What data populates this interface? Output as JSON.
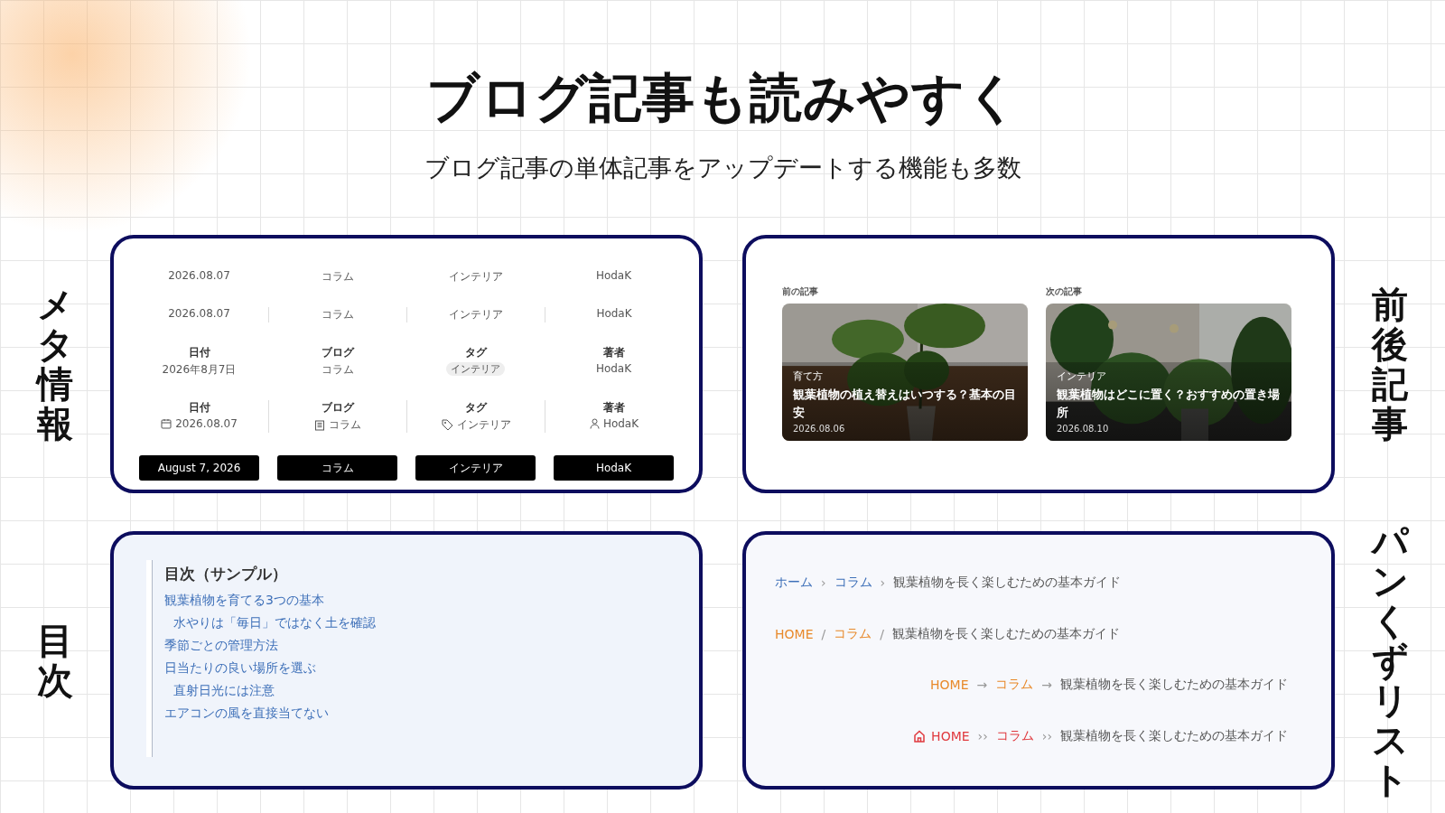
{
  "title": "ブログ記事も読みやすく",
  "subtitle": "ブログ記事の単体記事をアップデートする機能も多数",
  "meta": {
    "side_label": "メタ情報",
    "rows": [
      {
        "kind": "plain",
        "items": [
          {
            "value": "2026.08.07"
          },
          {
            "value": "コラム"
          },
          {
            "value": "インテリア"
          },
          {
            "value": "HodaK"
          }
        ]
      },
      {
        "kind": "divided",
        "items": [
          {
            "value": "2026.08.07"
          },
          {
            "value": "コラム"
          },
          {
            "value": "インテリア"
          },
          {
            "value": "HodaK"
          }
        ]
      },
      {
        "kind": "labeled",
        "items": [
          {
            "label": "日付",
            "value": "2026年8月7日"
          },
          {
            "label": "ブログ",
            "value": "コラム"
          },
          {
            "label": "タグ",
            "value": "インテリア",
            "pill": true
          },
          {
            "label": "著者",
            "value": "HodaK"
          }
        ]
      },
      {
        "kind": "icons",
        "items": [
          {
            "label": "日付",
            "value": "2026.08.07"
          },
          {
            "label": "ブログ",
            "value": "コラム"
          },
          {
            "label": "タグ",
            "value": "インテリア"
          },
          {
            "label": "著者",
            "value": "HodaK"
          }
        ]
      },
      {
        "kind": "buttons",
        "items": [
          {
            "value": "August 7, 2026"
          },
          {
            "value": "コラム"
          },
          {
            "value": "インテリア"
          },
          {
            "value": "HodaK"
          }
        ]
      }
    ]
  },
  "adjacent": {
    "side_label": "前後記事",
    "cards": [
      {
        "heading": "前の記事",
        "category": "育て方",
        "title": "観葉植物の植え替えはいつする？基本の目安",
        "date": "2026.08.06",
        "kind": "picture"
      },
      {
        "heading": "次の記事",
        "category": "インテリア",
        "title": "観葉植物はどこに置く？おすすめの置き場所",
        "date": "2026.08.10",
        "kind": "picture"
      }
    ]
  },
  "toc": {
    "side_label": "目次",
    "title": "目次（サンプル）",
    "items": [
      {
        "text": "観葉植物を育てる3つの基本",
        "children": [
          {
            "text": "水やりは「毎日」ではなく土を確認"
          }
        ]
      },
      {
        "text": "季節ごとの管理方法"
      },
      {
        "text": "日当たりの良い場所を選ぶ",
        "children": [
          {
            "text": "直射日光には注意"
          }
        ]
      },
      {
        "text": "エアコンの風を直接当てない"
      }
    ]
  },
  "breadcrumbs": {
    "side_label": "パンくずリスト",
    "rows": [
      {
        "kind": "chevron",
        "color": "#3d6fb8",
        "links": [
          "ホーム",
          "コラム"
        ],
        "separator": "›",
        "current": "観葉植物を長く楽しむための基本ガイド"
      },
      {
        "kind": "slash",
        "color": "#e8892a",
        "links": [
          "HOME",
          "コラム"
        ],
        "separator": "/",
        "current": "観葉植物を長く楽しむための基本ガイド"
      },
      {
        "kind": "arrow",
        "color": "#e8892a",
        "links": [
          "HOME",
          "コラム"
        ],
        "separator": "→",
        "current": "観葉植物を長く楽しむための基本ガイド"
      },
      {
        "kind": "double",
        "color": "#e0393e",
        "links": [
          "HOME",
          "コラム"
        ],
        "separator": "››",
        "current": "観葉植物を長く楽しむための基本ガイド"
      }
    ]
  }
}
